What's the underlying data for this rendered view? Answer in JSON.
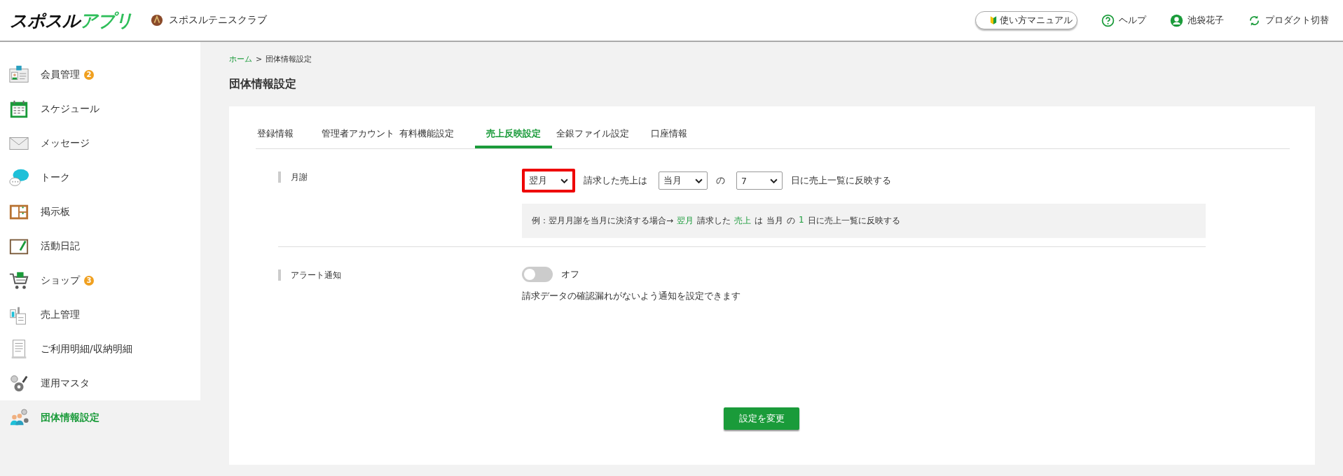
{
  "header": {
    "logo": {
      "main": "スポスル",
      "accent": "アプリ"
    },
    "club": "スポスルテニスクラブ",
    "manual": "使い方マニュアル",
    "help": "ヘルプ",
    "user": "池袋花子",
    "switch": "プロダクト切替"
  },
  "sidebar": {
    "items": [
      {
        "label": "会員管理",
        "badge": "2",
        "selected": false
      },
      {
        "label": "スケジュール",
        "selected": false
      },
      {
        "label": "メッセージ",
        "selected": false
      },
      {
        "label": "トーク",
        "selected": false
      },
      {
        "label": "掲示板",
        "selected": false
      },
      {
        "label": "活動日記",
        "selected": false
      },
      {
        "label": "ショップ",
        "badge": "3",
        "selected": false
      },
      {
        "label": "売上管理",
        "selected": false
      },
      {
        "label": "ご利用明細/収納明細",
        "selected": false
      },
      {
        "label": "運用マスタ",
        "selected": false
      },
      {
        "label": "団体情報設定",
        "selected": true
      }
    ]
  },
  "breadcrumb": {
    "home": "ホーム",
    "separator": ">",
    "current": "団体情報設定"
  },
  "title": "団体情報設定",
  "tabs": [
    {
      "label": "登録情報",
      "selected": false
    },
    {
      "label": "管理者アカウント",
      "selected": false
    },
    {
      "label": "有料機能設定",
      "selected": false
    },
    {
      "label": "売上反映設定",
      "selected": true
    },
    {
      "label": "全銀ファイル設定",
      "selected": false
    },
    {
      "label": "口座情報",
      "selected": false
    }
  ],
  "fee": {
    "label": "月謝",
    "month_select": {
      "value": "翌月",
      "highlighted": true
    },
    "text_1": "請求した売上は",
    "target_select": {
      "value": "当月",
      "highlighted": false
    },
    "text_2": "の",
    "day_select": {
      "value": "7",
      "highlighted": false
    },
    "text_3": "日に売上一覧に反映する",
    "example": [
      {
        "text": "例：翌月月謝を当月に決済する場合→",
        "accent": false
      },
      {
        "text": "翌月",
        "accent": true
      },
      {
        "text": "請求した",
        "accent": false
      },
      {
        "text": "売上",
        "accent": true
      },
      {
        "text": "は",
        "accent": false
      },
      {
        "text": "当月",
        "accent": false
      },
      {
        "text": "の",
        "accent": false
      },
      {
        "text": "1",
        "accent": true
      },
      {
        "text": "日に売上一覧に反映する",
        "accent": false
      }
    ]
  },
  "alert": {
    "label": "アラート通知",
    "on": false,
    "state_label": "オフ",
    "description": "請求データの確認漏れがないよう通知を設定できます"
  },
  "submit": "設定を変更"
}
